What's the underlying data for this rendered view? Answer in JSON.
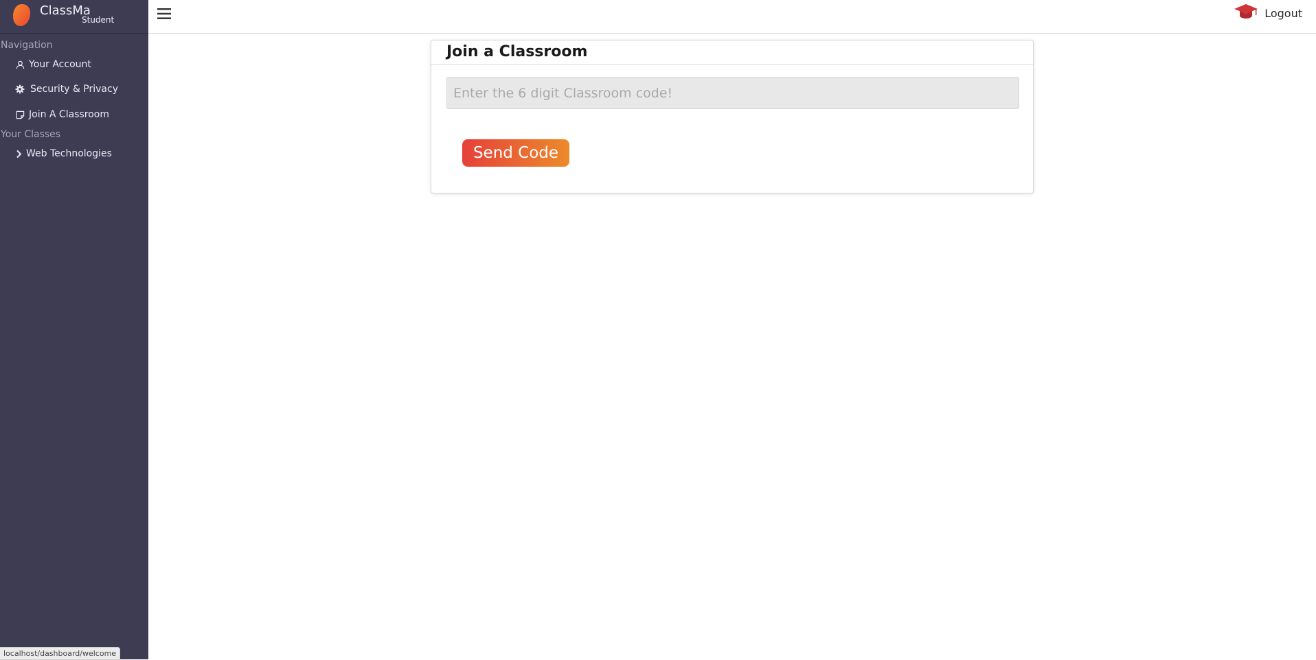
{
  "brand": {
    "name": "ClassMa",
    "role": "Student"
  },
  "sidebar": {
    "nav_label": "Navigation",
    "items": [
      {
        "label": "Your Account",
        "icon": "user-icon"
      },
      {
        "label": "Security & Privacy",
        "icon": "gear-icon"
      },
      {
        "label": "Join A Classroom",
        "icon": "note-icon"
      }
    ],
    "classes_label": "Your Classes",
    "classes": [
      {
        "label": "Web Technologies",
        "icon": "chevron-right-icon"
      }
    ]
  },
  "topbar": {
    "menu_icon": "hamburger-icon",
    "cap_icon": "graduation-cap-icon",
    "logout_label": "Logout"
  },
  "card": {
    "title": "Join a Classroom",
    "input_placeholder": "Enter the 6 digit Classroom code!",
    "input_value": "",
    "button_label": "Send Code"
  },
  "status_bar": {
    "url": "localhost/dashboard/welcome"
  },
  "colors": {
    "sidebar_bg": "#3e3c53",
    "button_gradient_start": "#e6413a",
    "button_gradient_end": "#ec8a2a",
    "logo": "#f06a2c",
    "cap": "#d0353a"
  }
}
